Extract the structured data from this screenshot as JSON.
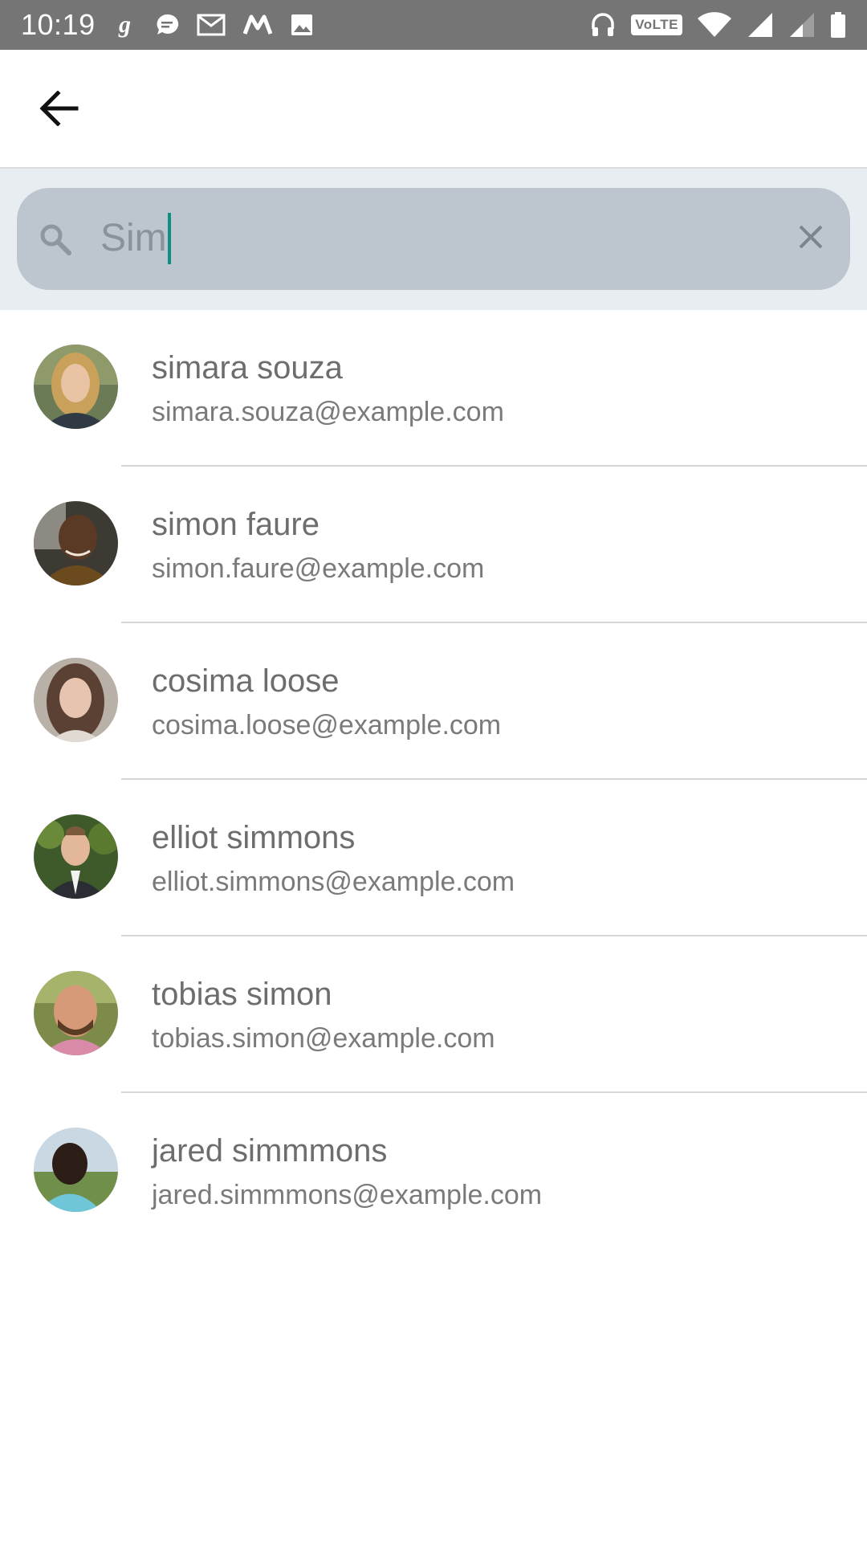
{
  "status_bar": {
    "time": "10:19",
    "left_icons": [
      "g-icon",
      "message-icon",
      "gmail-icon",
      "m-icon",
      "image-icon"
    ],
    "volte_label": "VoLTE",
    "right_icons": [
      "headphones-icon",
      "volte-icon",
      "wifi-icon",
      "signal-icon",
      "signal-weak-icon",
      "battery-icon"
    ]
  },
  "toolbar": {
    "back_icon": "arrow-back-icon"
  },
  "search": {
    "value": "Sim",
    "search_icon": "search-icon",
    "clear_icon": "close-icon",
    "caret_color": "#0e8f82"
  },
  "contacts": [
    {
      "name": "simara souza",
      "email": "simara.souza@example.com",
      "avatar": "avatar-photo"
    },
    {
      "name": "simon faure",
      "email": "simon.faure@example.com",
      "avatar": "avatar-photo"
    },
    {
      "name": "cosima loose",
      "email": "cosima.loose@example.com",
      "avatar": "avatar-photo"
    },
    {
      "name": "elliot simmons",
      "email": "elliot.simmons@example.com",
      "avatar": "avatar-photo"
    },
    {
      "name": "tobias simon",
      "email": "tobias.simon@example.com",
      "avatar": "avatar-photo"
    },
    {
      "name": "jared simmmons",
      "email": "jared.simmmons@example.com",
      "avatar": "avatar-photo"
    }
  ],
  "colors": {
    "status_bar": "#757575",
    "search_area": "#e8edf2",
    "search_box": "#bdc5ce",
    "text_primary": "#6d6d6d"
  }
}
